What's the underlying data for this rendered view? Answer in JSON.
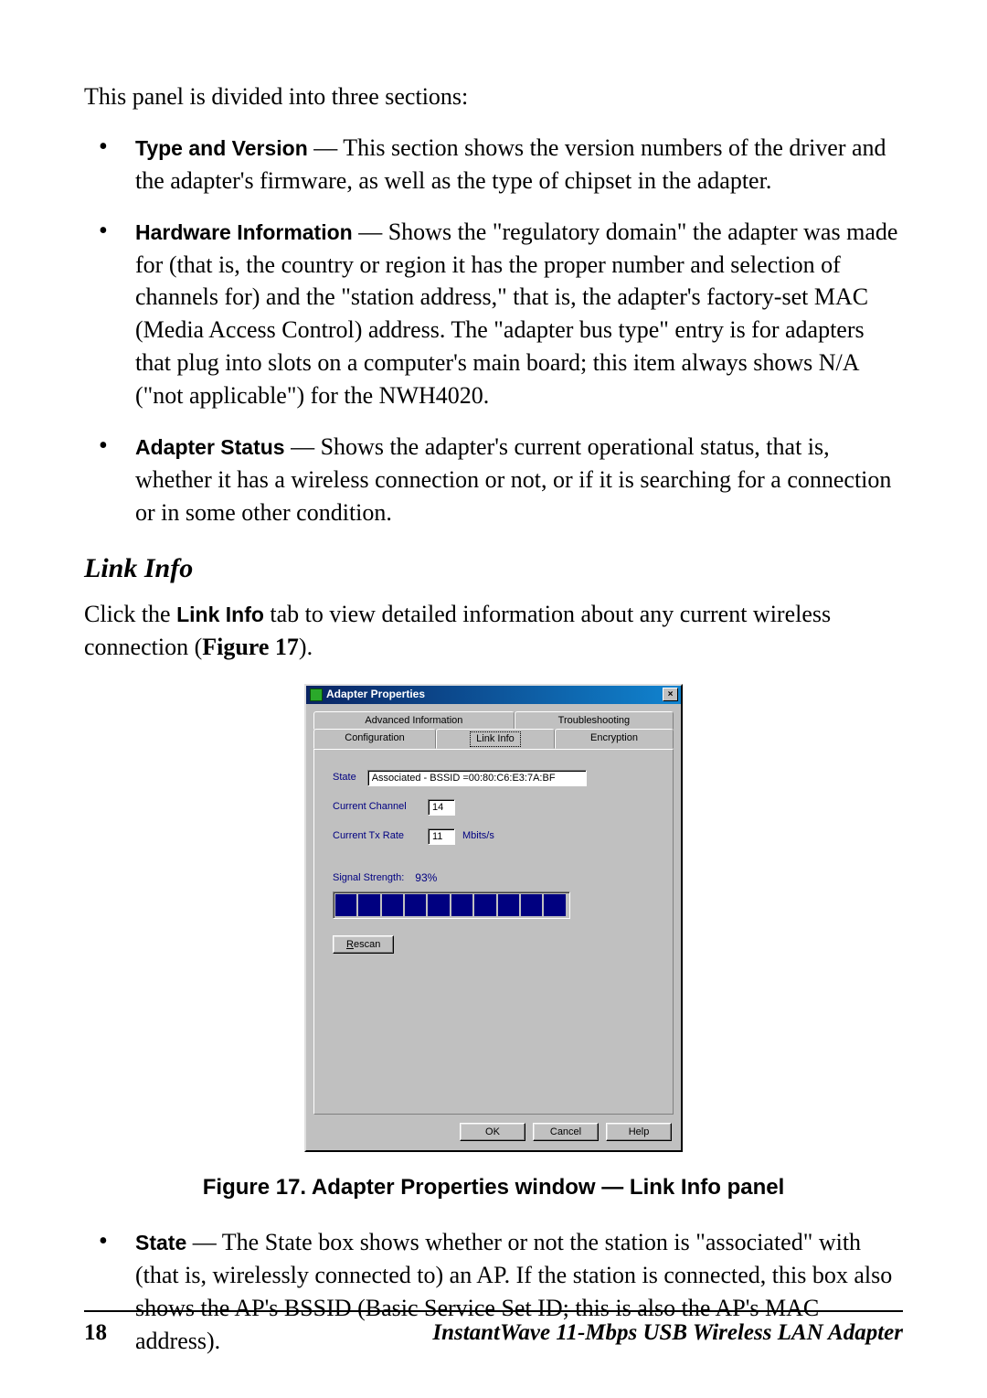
{
  "intro": "This panel is divided into three sections:",
  "bullets_top": [
    {
      "label": "Type and Version",
      "text": " — This section shows the version numbers of the driver and the adapter's firmware, as well as the type of chipset in the adapter."
    },
    {
      "label": "Hardware Information",
      "text": " — Shows the \"regulatory domain\" the adapter was made for (that is, the country or region it has the proper number and selection of channels for) and the \"station address,\" that is, the adapter's factory-set MAC (Media Access Control) address. The \"adapter bus type\" entry is for adapters that plug into slots on a computer's main board; this item always shows N/A (\"not applicable\") for the NWH4020."
    },
    {
      "label": "Adapter Status",
      "text": " — Shows the adapter's current operational status, that is, whether it has a wireless connection or not, or if it is searching for a connection or in some other condition."
    }
  ],
  "heading": "Link Info",
  "after_heading_prefix": "Click the ",
  "after_heading_label": "Link Info",
  "after_heading_mid": " tab to view detailed information about any current wireless connection (",
  "after_heading_fig": "Figure 17",
  "after_heading_suffix": ").",
  "dialog": {
    "title": "Adapter Properties",
    "close": "×",
    "tabs_row1": {
      "advanced": "Advanced Information",
      "troubleshooting": "Troubleshooting"
    },
    "tabs_row2": {
      "configuration": "Configuration",
      "linkinfo": "Link Info",
      "encryption": "Encryption"
    },
    "state_label": "State",
    "state_value": "Associated - BSSID =00:80:C6:E3:7A:BF",
    "channel_label": "Current Channel",
    "channel_value": "14",
    "txrate_label": "Current Tx Rate",
    "txrate_value": "11",
    "txrate_unit": "Mbits/s",
    "signal_label": "Signal Strength:",
    "signal_pct": "93%",
    "rescan_u": "R",
    "rescan_rest": "escan",
    "ok": "OK",
    "cancel": "Cancel",
    "help": "Help"
  },
  "figure_caption": "Figure 17. Adapter Properties window — Link Info panel",
  "bullets_bottom": [
    {
      "label": "State",
      "text": " — The State box shows whether or not the station is \"associated\" with (that is, wirelessly connected to) an AP. If the station is connected, this box also shows the AP's BSSID (Basic Service Set ID; this is also the AP's MAC address)."
    }
  ],
  "footer": {
    "page": "18",
    "doc": "InstantWave 11-Mbps USB Wireless LAN Adapter"
  }
}
